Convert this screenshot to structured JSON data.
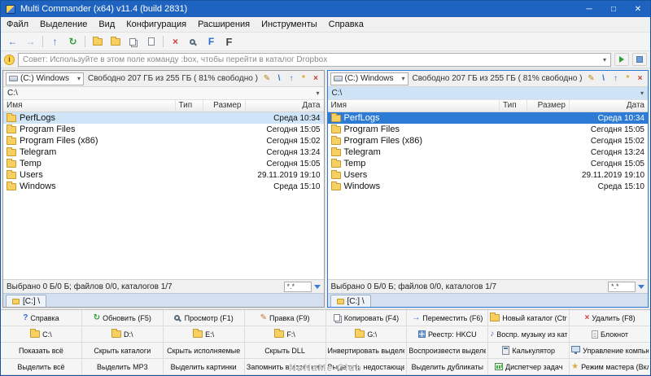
{
  "window": {
    "title": "Multi Commander (x64)  v11.4 (build 2831)",
    "minimize": "─",
    "maximize": "□",
    "close": "✕"
  },
  "menu": {
    "items": [
      "Файл",
      "Выделение",
      "Вид",
      "Конфигурация",
      "Расширения",
      "Инструменты",
      "Справка"
    ]
  },
  "toolbar": {
    "buttons": [
      {
        "name": "back-icon",
        "kind": "glyph",
        "glyph": "←",
        "color": "#2a6fd0"
      },
      {
        "name": "forward-icon",
        "kind": "glyph",
        "glyph": "→",
        "color": "#8fb3e0"
      },
      {
        "name": "toolbar-separator",
        "kind": "sep"
      },
      {
        "name": "folder-up-icon",
        "kind": "glyph",
        "glyph": "↑",
        "color": "#2a6fd0"
      },
      {
        "name": "refresh-icon",
        "kind": "glyph",
        "glyph": "↻",
        "color": "#2e9e3a"
      },
      {
        "name": "toolbar-separator",
        "kind": "sep"
      },
      {
        "name": "new-folder-icon",
        "kind": "folder"
      },
      {
        "name": "favorites-folder-icon",
        "kind": "folder"
      },
      {
        "name": "copy-icon",
        "kind": "copy"
      },
      {
        "name": "document-icon",
        "kind": "doc"
      },
      {
        "name": "toolbar-separator",
        "kind": "sep"
      },
      {
        "name": "delete-icon",
        "kind": "glyph",
        "glyph": "×",
        "color": "#d23b3b"
      },
      {
        "name": "search-icon",
        "kind": "magnifier"
      },
      {
        "name": "font-small-icon",
        "kind": "glyph",
        "glyph": "F",
        "color": "#2a6fd0"
      },
      {
        "name": "font-large-icon",
        "kind": "glyph",
        "glyph": "F",
        "color": "#444444"
      }
    ]
  },
  "command_bar": {
    "hint": "Совет: Используйте в этом поле команду :box, чтобы перейти в каталог Dropbox"
  },
  "panel_tools": [
    {
      "name": "edit-icon",
      "glyph": "✎",
      "color": "#b8860b"
    },
    {
      "name": "root-icon",
      "glyph": "\\",
      "color": "#2a6fd0"
    },
    {
      "name": "up-icon",
      "glyph": "↑",
      "color": "#2a6fd0"
    },
    {
      "name": "star-icon",
      "glyph": "*",
      "color": "#d9a21b"
    },
    {
      "name": "close-icon",
      "glyph": "×",
      "color": "#c0392b"
    }
  ],
  "panels": {
    "left": {
      "active": false,
      "drive": "(C:) Windows",
      "free_space": "Свободно 207 ГБ из 255 ГБ ( 81% свободно )",
      "path": "C:\\",
      "columns": [
        "Имя",
        "Тип",
        "Размер",
        "Дата"
      ],
      "files": [
        {
          "name": "PerfLogs",
          "date": "Среда 10:34",
          "selected": true
        },
        {
          "name": "Program Files",
          "date": "Сегодня 15:05"
        },
        {
          "name": "Program Files (x86)",
          "date": "Сегодня 15:02"
        },
        {
          "name": "Telegram",
          "date": "Сегодня 13:24"
        },
        {
          "name": "Temp",
          "date": "Сегодня 15:05"
        },
        {
          "name": "Users",
          "date": "29.11.2019 19:10"
        },
        {
          "name": "Windows",
          "date": "Среда 15:10"
        }
      ],
      "status": "Выбрано 0 Б/0 Б; файлов 0/0, каталогов 1/7",
      "filter": "*.*",
      "tab": "[C:] \\"
    },
    "right": {
      "active": true,
      "drive": "(C:) Windows",
      "free_space": "Свободно 207 ГБ из 255 ГБ ( 81% свободно )",
      "path": "C:\\",
      "columns": [
        "Имя",
        "Тип",
        "Размер",
        "Дата"
      ],
      "files": [
        {
          "name": "PerfLogs",
          "date": "Среда 10:34",
          "selected": true
        },
        {
          "name": "Program Files",
          "date": "Сегодня 15:05"
        },
        {
          "name": "Program Files (x86)",
          "date": "Сегодня 15:02"
        },
        {
          "name": "Telegram",
          "date": "Сегодня 13:24"
        },
        {
          "name": "Temp",
          "date": "Сегодня 15:05"
        },
        {
          "name": "Users",
          "date": "29.11.2019 19:10"
        },
        {
          "name": "Windows",
          "date": "Среда 15:10"
        }
      ],
      "status": "Выбрано 0 Б/0 Б; файлов 0/0, каталогов 1/7",
      "filter": "*.*",
      "tab": "[C:] \\"
    }
  },
  "button_grid": {
    "rows": [
      [
        {
          "label": "Справка",
          "icon": "help"
        },
        {
          "label": "Обновить (F5)",
          "icon": "refresh"
        },
        {
          "label": "Просмотр (F1)",
          "icon": "view"
        },
        {
          "label": "Правка (F9)",
          "icon": "edit"
        },
        {
          "label": "Копировать (F4)",
          "icon": "copy"
        },
        {
          "label": "Переместить (F6)",
          "icon": "move"
        },
        {
          "label": "Новый каталог (Ctrl+Shift+Alt+)",
          "icon": "newfolder"
        },
        {
          "label": "Удалить (F8)",
          "icon": "delete"
        }
      ],
      [
        {
          "label": "C:\\",
          "icon": "folder"
        },
        {
          "label": "D:\\",
          "icon": "folder"
        },
        {
          "label": "E:\\",
          "icon": "folder"
        },
        {
          "label": "F:\\",
          "icon": "folder"
        },
        {
          "label": "G:\\",
          "icon": "folder"
        },
        {
          "label": "Реестр: HKCU",
          "icon": "registry"
        },
        {
          "label": "Воспр. музыку из каталога",
          "icon": "music"
        },
        {
          "label": "Блокнот",
          "icon": "notepad"
        }
      ],
      [
        {
          "label": "Показать всё",
          "icon": null
        },
        {
          "label": "Скрыть каталоги",
          "icon": null
        },
        {
          "label": "Скрыть исполняемые",
          "icon": null
        },
        {
          "label": "Скрыть DLL",
          "icon": null
        },
        {
          "label": "Инвертировать выделение",
          "icon": null
        },
        {
          "label": "Воспроизвести выделение",
          "icon": null
        },
        {
          "label": "Калькулятор",
          "icon": "calc"
        },
        {
          "label": "Управление компьютером",
          "icon": "computer"
        }
      ],
      [
        {
          "label": "Выделить всё",
          "icon": null
        },
        {
          "label": "Выделить MP3",
          "icon": null
        },
        {
          "label": "Выделить картинки",
          "icon": null
        },
        {
          "label": "Запомнить выделение",
          "icon": null
        },
        {
          "label": "Выделить недостающее",
          "icon": null
        },
        {
          "label": "Выделить дубликаты",
          "icon": null
        },
        {
          "label": "Диспетчер задач",
          "icon": "taskmgr"
        },
        {
          "label": "Режим мастера (Вкл/Выкл)",
          "icon": "wizard"
        }
      ]
    ]
  },
  "watermark": {
    "text": "NoNaMe-Club"
  }
}
